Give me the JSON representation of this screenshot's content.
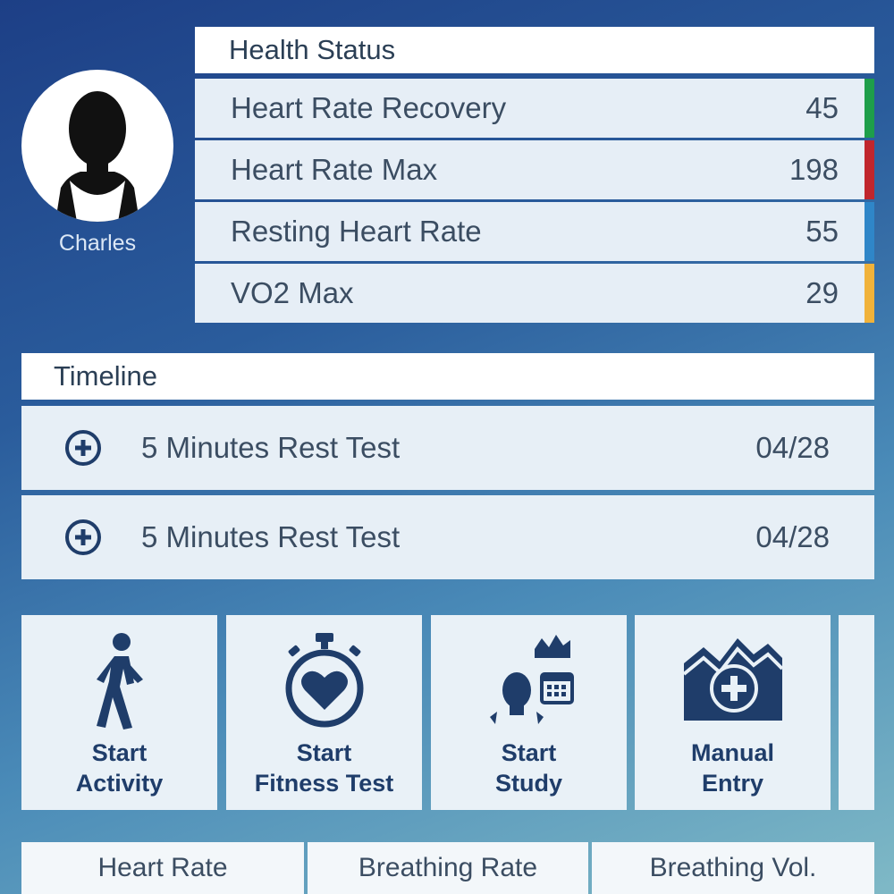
{
  "user": {
    "name": "Charles"
  },
  "health_status": {
    "title": "Health Status",
    "rows": [
      {
        "label": "Heart Rate Recovery",
        "value": "45",
        "color": "#1e9e4a"
      },
      {
        "label": "Heart Rate Max",
        "value": "198",
        "color": "#c0262d"
      },
      {
        "label": "Resting Heart Rate",
        "value": "55",
        "color": "#2f86c8"
      },
      {
        "label": "VO2 Max",
        "value": "29",
        "color": "#f0b23a"
      }
    ]
  },
  "timeline": {
    "title": "Timeline",
    "items": [
      {
        "label": "5 Minutes Rest Test",
        "date": "04/28",
        "icon": "plus-circle-icon"
      },
      {
        "label": "5 Minutes Rest Test",
        "date": "04/28",
        "icon": "plus-circle-icon"
      }
    ]
  },
  "actions": [
    {
      "line1": "Start",
      "line2": "Activity",
      "icon": "walking-person-icon"
    },
    {
      "line1": "Start",
      "line2": "Fitness Test",
      "icon": "stopwatch-heart-icon"
    },
    {
      "line1": "Start",
      "line2": "Study",
      "icon": "study-person-calendar-icon"
    },
    {
      "line1": "Manual",
      "line2": "Entry",
      "icon": "chart-plus-icon"
    }
  ],
  "tabs": [
    "Heart Rate",
    "Breathing Rate",
    "Breathing Vol."
  ],
  "colors": {
    "accent": "#1f3d6a",
    "panel": "#e9f1f7",
    "header": "#ffffff"
  }
}
